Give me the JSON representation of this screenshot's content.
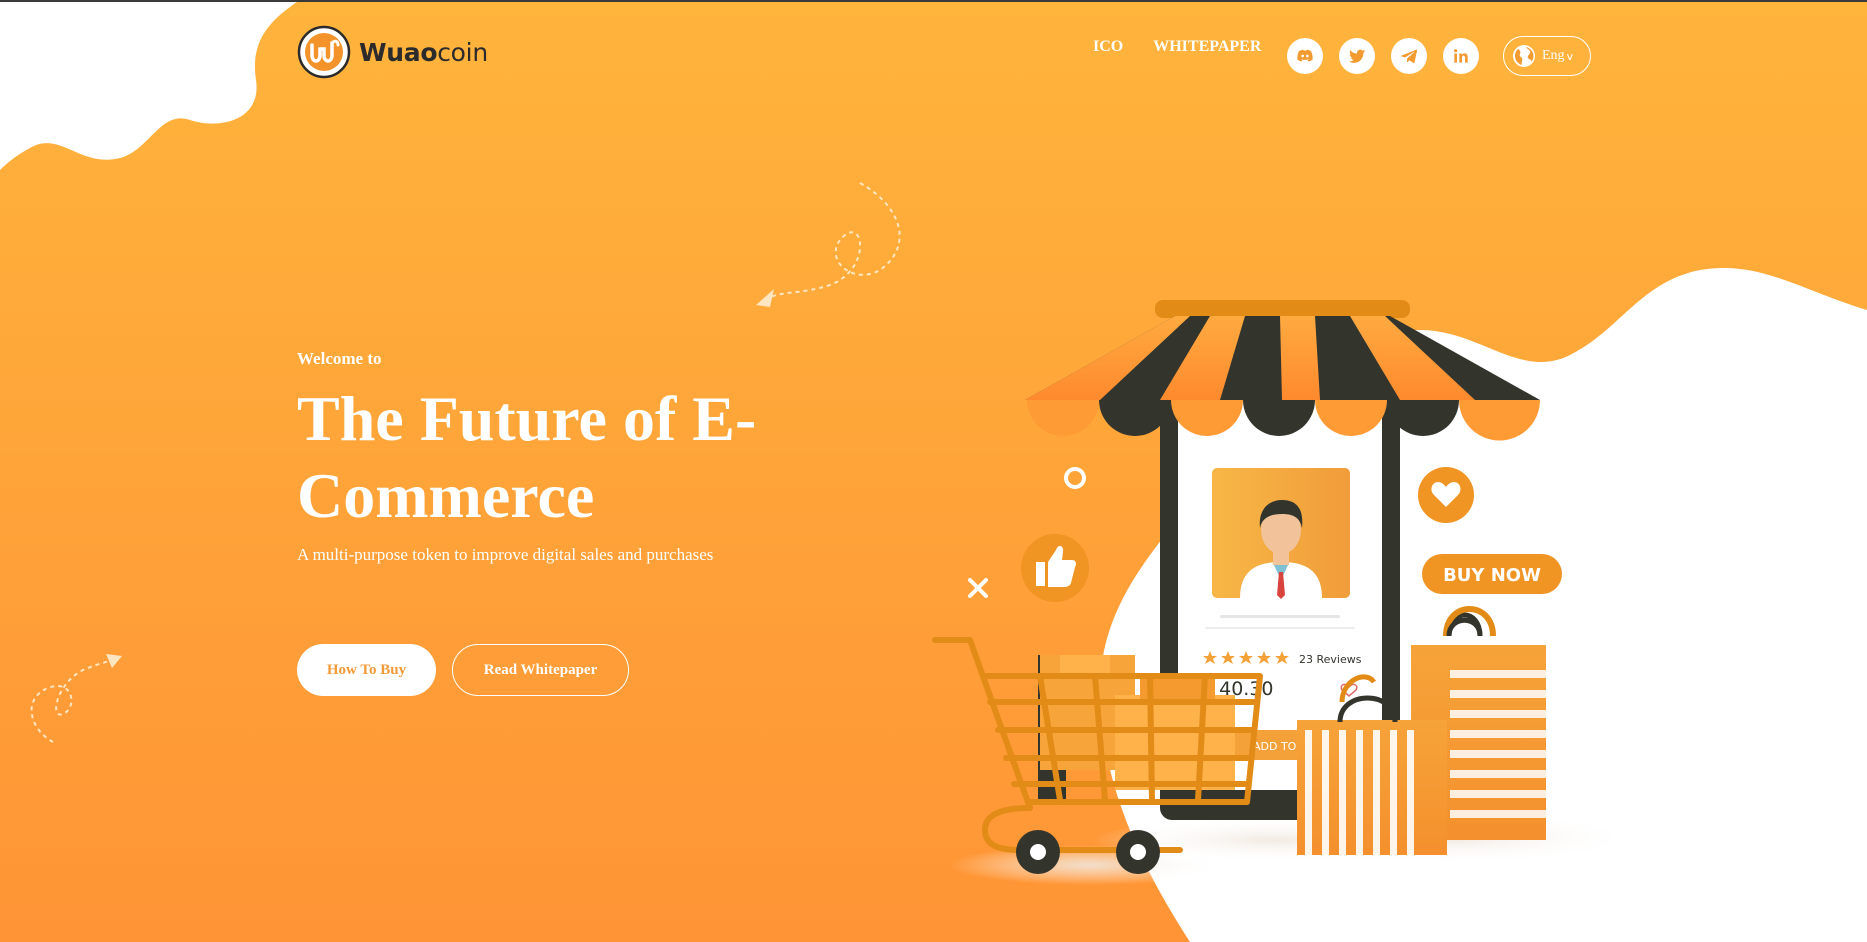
{
  "brand": {
    "name_bold": "Wuao",
    "name_rest": "coin"
  },
  "nav": {
    "links": [
      "ICO",
      "WHITEPAPER"
    ]
  },
  "socials": [
    "discord-icon",
    "twitter-icon",
    "telegram-icon",
    "linkedin-icon"
  ],
  "language": {
    "label": "Eng",
    "caret": "v"
  },
  "hero": {
    "welcome": "Welcome to",
    "headline": "The Future of E-Commerce",
    "subtitle": "A multi-purpose token to improve digital sales and purchases",
    "primary_button": "How To Buy",
    "secondary_button": "Read Whitepaper"
  },
  "illustration": {
    "buy_now": "BUY NOW",
    "reviews": "23 Reviews",
    "price": "$ 40.30",
    "add_to_cart": "ADD TO C"
  },
  "colors": {
    "orange_top": "#ffb43c",
    "orange_bottom": "#ff9436",
    "dark": "#33352d",
    "white": "#ffffff"
  }
}
